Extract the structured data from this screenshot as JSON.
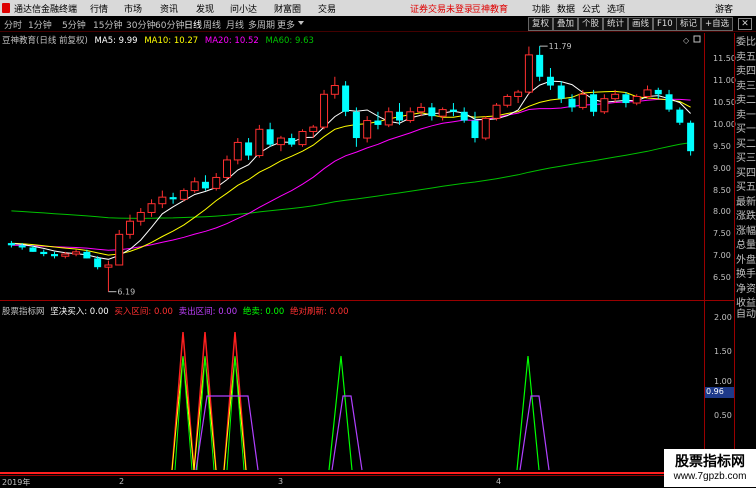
{
  "titlebar": {
    "app_name": "通达信金融终端",
    "menus": [
      "行情",
      "市场",
      "资讯",
      "发现",
      "问小达",
      "财富圈",
      "交易"
    ],
    "alert": "证券交易未登录",
    "brand": "豆神教育",
    "right_menus": [
      "功能",
      "数据",
      "公式",
      "选项"
    ],
    "guest": "游客"
  },
  "tabs": [
    "分时",
    "1分钟",
    "5分钟",
    "15分钟",
    "30分钟",
    "60分钟",
    "日线",
    "周线",
    "月线",
    "多周期",
    "更多"
  ],
  "active_tab": "日线",
  "right_buttons": [
    "复权",
    "叠加",
    "个股",
    "统计",
    "画线",
    "F10",
    "标记",
    "+自选"
  ],
  "main_legend": {
    "title": "豆神教育(日线 前复权)",
    "ma5": "MA5: 9.99",
    "ma10": "MA10: 10.27",
    "ma20": "MA20: 10.52",
    "ma60": "MA60: 9.63"
  },
  "colors": {
    "ma5": "#ffffff",
    "ma10": "#ffff00",
    "ma20": "#ff00ff",
    "ma60": "#00c000",
    "up": "#ff3030",
    "down": "#00ffff"
  },
  "price_axis": [
    "11.50",
    "11.00",
    "10.50",
    "10.00",
    "9.50",
    "9.00",
    "8.50",
    "8.00",
    "7.50",
    "7.00",
    "6.50"
  ],
  "high_label": "11.79",
  "low_label": "6.19",
  "sub_legend": {
    "title": "股票指标网",
    "jjmr": "坚决买入: 0.00",
    "mrqj": "买入区间: 0.00",
    "mcqj": "卖出区间: 0.00",
    "jm": "绝卖: 0.00",
    "jdhb": "绝对刷新: 0.00"
  },
  "sub_axis": [
    "2.00",
    "1.50",
    "1.00",
    "0.50"
  ],
  "sub_marker": "0.96",
  "dates": [
    "2019年",
    "2",
    "3",
    "4"
  ],
  "right_panel": [
    "委比",
    "卖五",
    "卖四",
    "卖三",
    "卖二",
    "卖一",
    "买一",
    "买二",
    "买三",
    "买四",
    "买五",
    "最新",
    "涨跌",
    "涨幅",
    "总量",
    "外盘",
    "换手",
    "净资",
    "收益"
  ],
  "right_auto": "自动",
  "watermark": "股票指标网",
  "watermark_url": "www.7gpzb.com",
  "chart_data": {
    "type": "candlestick",
    "candles": [
      [
        7.3,
        7.35,
        7.2,
        7.25
      ],
      [
        7.25,
        7.3,
        7.15,
        7.2
      ],
      [
        7.2,
        7.25,
        7.1,
        7.1
      ],
      [
        7.1,
        7.15,
        7.0,
        7.05
      ],
      [
        7.05,
        7.1,
        6.95,
        7.0
      ],
      [
        7.0,
        7.1,
        6.95,
        7.05
      ],
      [
        7.05,
        7.15,
        7.0,
        7.1
      ],
      [
        7.1,
        7.15,
        6.95,
        6.95
      ],
      [
        6.95,
        7.0,
        6.7,
        6.75
      ],
      [
        6.75,
        6.9,
        6.19,
        6.8
      ],
      [
        6.8,
        7.6,
        6.8,
        7.5
      ],
      [
        7.5,
        7.95,
        7.4,
        7.8
      ],
      [
        7.8,
        8.1,
        7.7,
        8.0
      ],
      [
        8.0,
        8.3,
        7.9,
        8.2
      ],
      [
        8.2,
        8.5,
        8.1,
        8.35
      ],
      [
        8.35,
        8.45,
        8.2,
        8.3
      ],
      [
        8.3,
        8.55,
        8.25,
        8.5
      ],
      [
        8.5,
        8.8,
        8.45,
        8.7
      ],
      [
        8.7,
        8.85,
        8.5,
        8.55
      ],
      [
        8.55,
        8.9,
        8.5,
        8.8
      ],
      [
        8.8,
        9.3,
        8.75,
        9.2
      ],
      [
        9.2,
        9.7,
        9.1,
        9.6
      ],
      [
        9.6,
        9.7,
        9.2,
        9.3
      ],
      [
        9.3,
        10.0,
        9.25,
        9.9
      ],
      [
        9.9,
        10.05,
        9.5,
        9.55
      ],
      [
        9.55,
        9.75,
        9.4,
        9.7
      ],
      [
        9.7,
        9.8,
        9.5,
        9.55
      ],
      [
        9.55,
        9.9,
        9.5,
        9.85
      ],
      [
        9.85,
        10.0,
        9.7,
        9.95
      ],
      [
        9.95,
        10.8,
        9.9,
        10.7
      ],
      [
        10.7,
        11.1,
        10.6,
        10.9
      ],
      [
        10.9,
        11.0,
        10.2,
        10.3
      ],
      [
        10.3,
        10.4,
        9.5,
        9.7
      ],
      [
        9.7,
        10.2,
        9.6,
        10.1
      ],
      [
        10.1,
        10.3,
        9.9,
        10.0
      ],
      [
        10.0,
        10.4,
        9.95,
        10.3
      ],
      [
        10.3,
        10.5,
        10.0,
        10.1
      ],
      [
        10.1,
        10.4,
        10.05,
        10.3
      ],
      [
        10.3,
        10.5,
        10.2,
        10.4
      ],
      [
        10.4,
        10.5,
        10.1,
        10.2
      ],
      [
        10.2,
        10.4,
        10.1,
        10.35
      ],
      [
        10.35,
        10.5,
        10.2,
        10.3
      ],
      [
        10.3,
        10.4,
        10.05,
        10.1
      ],
      [
        10.1,
        10.3,
        9.6,
        9.7
      ],
      [
        9.7,
        10.2,
        9.65,
        10.15
      ],
      [
        10.15,
        10.5,
        10.1,
        10.45
      ],
      [
        10.45,
        10.7,
        10.4,
        10.65
      ],
      [
        10.65,
        10.8,
        10.5,
        10.75
      ],
      [
        10.75,
        11.79,
        10.7,
        11.6
      ],
      [
        11.6,
        11.8,
        11.0,
        11.1
      ],
      [
        11.1,
        11.3,
        10.8,
        10.9
      ],
      [
        10.9,
        11.0,
        10.5,
        10.6
      ],
      [
        10.6,
        10.7,
        10.3,
        10.4
      ],
      [
        10.4,
        10.8,
        10.35,
        10.7
      ],
      [
        10.7,
        10.8,
        10.2,
        10.3
      ],
      [
        10.3,
        10.7,
        10.25,
        10.6
      ],
      [
        10.6,
        10.8,
        10.5,
        10.7
      ],
      [
        10.7,
        10.75,
        10.4,
        10.5
      ],
      [
        10.5,
        10.7,
        10.45,
        10.65
      ],
      [
        10.65,
        10.9,
        10.6,
        10.8
      ],
      [
        10.8,
        10.85,
        10.6,
        10.7
      ],
      [
        10.7,
        10.8,
        10.3,
        10.35
      ],
      [
        10.35,
        10.4,
        10.0,
        10.05
      ],
      [
        10.05,
        10.1,
        9.3,
        9.4
      ]
    ],
    "ylim": [
      6.0,
      12.1
    ],
    "yticks": [
      11.5,
      11.0,
      10.5,
      10.0,
      9.5,
      9.0,
      8.5,
      8.0,
      7.5,
      7.0,
      6.5
    ]
  }
}
